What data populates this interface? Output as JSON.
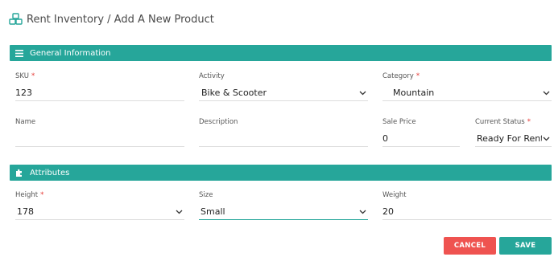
{
  "header": {
    "title": "Rent Inventory / Add A New Product",
    "logo_icon": "boxes-icon"
  },
  "sections": {
    "general": {
      "label": "General Information",
      "icon": "menu-icon"
    },
    "attributes": {
      "label": "Attributes",
      "icon": "puzzle-icon"
    }
  },
  "fields": {
    "sku": {
      "label": "SKU",
      "value": "123",
      "required": "*"
    },
    "activity": {
      "label": "Activity",
      "value": "Bike & Scooter"
    },
    "category": {
      "label": "Category",
      "value": "Mountain",
      "required": "*"
    },
    "name": {
      "label": "Name",
      "value": ""
    },
    "description": {
      "label": "Description",
      "value": ""
    },
    "sale_price": {
      "label": "Sale Price",
      "value": "0"
    },
    "current_status": {
      "label": "Current Status",
      "value": "Ready For Rent",
      "required": "*"
    },
    "height": {
      "label": "Height",
      "value": "178",
      "required": "*"
    },
    "size": {
      "label": "Size",
      "value": "Small"
    },
    "weight": {
      "label": "Weight",
      "value": "20"
    }
  },
  "buttons": {
    "cancel": "CANCEL",
    "save": "SAVE"
  },
  "colors": {
    "accent": "#26a69a",
    "danger": "#ef5350"
  }
}
